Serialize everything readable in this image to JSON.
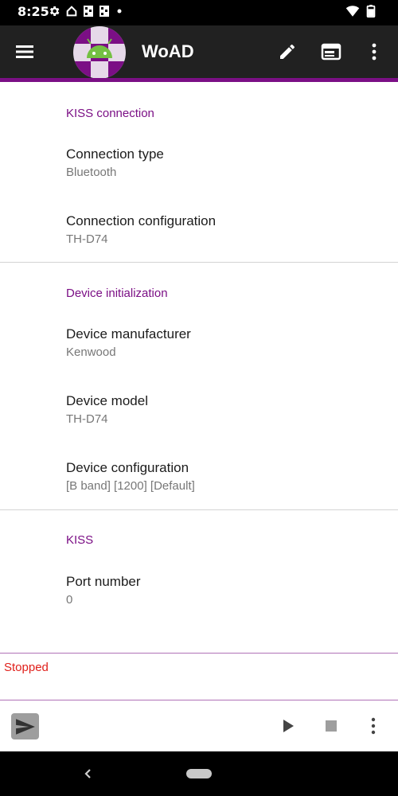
{
  "status_bar": {
    "time": "8:25",
    "left_icons": [
      "settings-icon",
      "home-icon",
      "sim-icon",
      "sim-icon",
      "dot-icon"
    ],
    "right_icons": [
      "wifi-icon",
      "battery-icon"
    ]
  },
  "toolbar": {
    "title": "WoAD",
    "actions": [
      "edit-icon",
      "web-asset-icon",
      "more-vert-icon"
    ],
    "accent_color": "#7b0f85",
    "background_color": "#212121"
  },
  "sections": [
    {
      "header": "KISS connection",
      "items": [
        {
          "title": "Connection type",
          "summary": "Bluetooth"
        },
        {
          "title": "Connection configuration",
          "summary": "TH-D74"
        }
      ]
    },
    {
      "header": "Device initialization",
      "items": [
        {
          "title": "Device manufacturer",
          "summary": "Kenwood"
        },
        {
          "title": "Device model",
          "summary": "TH-D74"
        },
        {
          "title": "Device configuration",
          "summary": "[B band] [1200] [Default]"
        }
      ]
    },
    {
      "header": "KISS",
      "items": [
        {
          "title": "Port number",
          "summary": "0"
        }
      ]
    }
  ],
  "status_panel": {
    "text": "Stopped",
    "color": "#e0201b"
  },
  "bottom_bar": {
    "actions": [
      "send-icon",
      "play-icon",
      "stop-icon",
      "more-vert-icon"
    ]
  },
  "nav_bar": {
    "actions": [
      "back-icon",
      "home-pill-icon"
    ]
  }
}
